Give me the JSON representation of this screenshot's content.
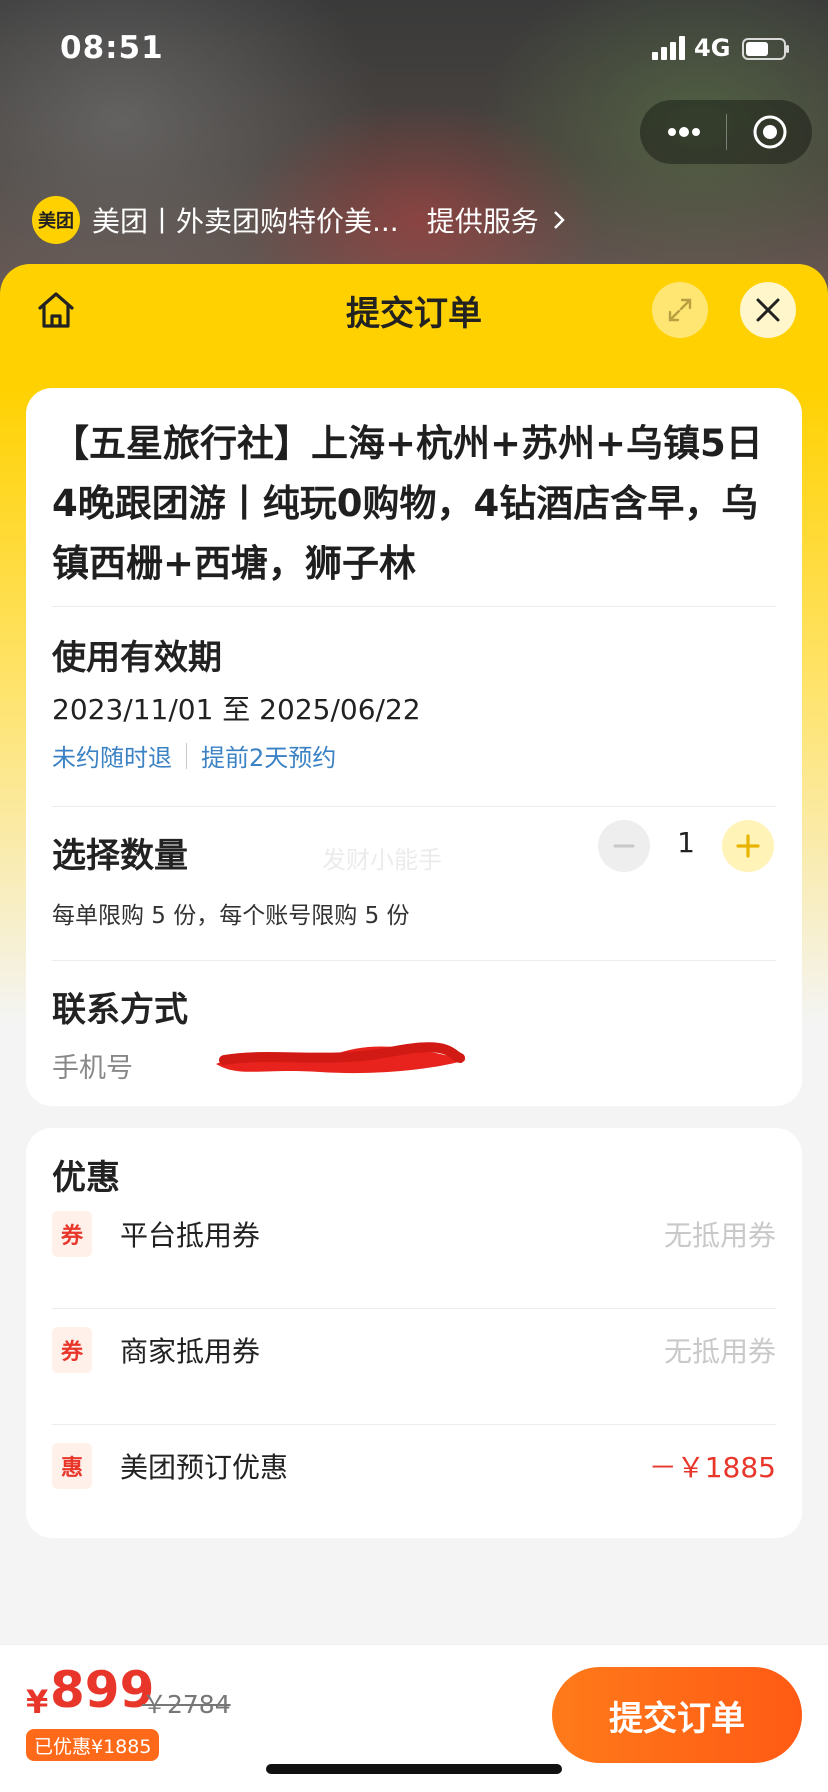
{
  "status_bar": {
    "time": "08:51",
    "network": "4G"
  },
  "provider": {
    "logo_text": "美团",
    "name": "美团丨外卖团购特价美...",
    "service": "提供服务"
  },
  "sheet": {
    "title": "提交订单"
  },
  "product": {
    "title": "【五星旅行社】上海+杭州+苏州+乌镇5日4晚跟团游丨纯玩0购物，4钻酒店含早，乌镇西栅+西塘，狮子林"
  },
  "validity": {
    "label": "使用有效期",
    "dates": "2023/11/01 至 2025/06/22",
    "tags": [
      "未约随时退",
      "提前2天预约"
    ]
  },
  "quantity": {
    "label": "选择数量",
    "value": "1",
    "limit_text": "每单限购 5 份，每个账号限购 5 份",
    "watermark": "发财小能手"
  },
  "contact": {
    "label": "联系方式",
    "phone_label": "手机号"
  },
  "discounts": {
    "title": "优惠",
    "rows": [
      {
        "badge": "券",
        "name": "平台抵用券",
        "value": "无抵用券"
      },
      {
        "badge": "券",
        "name": "商家抵用券",
        "value": "无抵用券"
      },
      {
        "badge": "惠",
        "name": "美团预订优惠",
        "value": "－￥1885"
      }
    ]
  },
  "footer": {
    "currency": "¥",
    "price": "899",
    "original_price": "￥2784",
    "saved": "已优惠¥1885",
    "submit_label": "提交订单"
  },
  "colors": {
    "brand_yellow": "#ffd100",
    "accent_red": "#e8362b",
    "submit_orange": "#ff6a1a",
    "link_blue": "#3b82c4"
  }
}
